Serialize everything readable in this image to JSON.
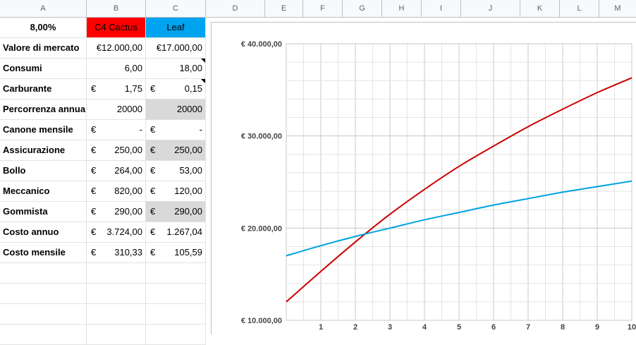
{
  "columns": [
    "A",
    "B",
    "C",
    "D",
    "E",
    "F",
    "G",
    "H",
    "I",
    "J",
    "K",
    "L",
    "M"
  ],
  "sheet": {
    "rate": "8,00%",
    "car_headers": [
      {
        "label": "C4 Cactus",
        "color": "#ff0000"
      },
      {
        "label": "Leaf",
        "color": "#00a3f0"
      }
    ],
    "rows": [
      {
        "label": "Valore di mercato",
        "b": {
          "cur": "",
          "val": "€12.000,00"
        },
        "c": {
          "cur": "",
          "val": "€17.000,00"
        }
      },
      {
        "label": "Consumi",
        "b": {
          "cur": "",
          "val": "6,00"
        },
        "c": {
          "cur": "",
          "val": "18,00"
        }
      },
      {
        "label": "Carburante",
        "b": {
          "cur": "€",
          "val": "1,75"
        },
        "c": {
          "cur": "€",
          "val": "0,15"
        }
      },
      {
        "label": "Percorrenza annua",
        "b": {
          "cur": "",
          "val": "20000"
        },
        "c": {
          "cur": "",
          "val": "20000"
        }
      },
      {
        "label": "Canone mensile",
        "b": {
          "cur": "€",
          "val": "-"
        },
        "c": {
          "cur": "€",
          "val": "-"
        }
      },
      {
        "label": "Assicurazione",
        "b": {
          "cur": "€",
          "val": "250,00"
        },
        "c": {
          "cur": "€",
          "val": "250,00"
        }
      },
      {
        "label": "Bollo",
        "b": {
          "cur": "€",
          "val": "264,00"
        },
        "c": {
          "cur": "€",
          "val": "53,00"
        }
      },
      {
        "label": "Meccanico",
        "b": {
          "cur": "€",
          "val": "820,00"
        },
        "c": {
          "cur": "€",
          "val": "120,00"
        }
      },
      {
        "label": "Gommista",
        "b": {
          "cur": "€",
          "val": "290,00"
        },
        "c": {
          "cur": "€",
          "val": "290,00"
        }
      },
      {
        "label": "Costo annuo",
        "b": {
          "cur": "€",
          "val": "3.724,00"
        },
        "c": {
          "cur": "€",
          "val": "1.267,04"
        }
      },
      {
        "label": "Costo mensile",
        "b": {
          "cur": "€",
          "val": "310,33"
        },
        "c": {
          "cur": "€",
          "val": "105,59"
        }
      }
    ]
  },
  "chart_data": {
    "type": "line",
    "x": [
      0,
      1,
      2,
      3,
      4,
      5,
      6,
      7,
      8,
      9,
      10
    ],
    "x_tick_labels": [
      "1",
      "2",
      "3",
      "4",
      "5",
      "6",
      "7",
      "8",
      "9",
      "10"
    ],
    "y_tick_labels": [
      "€ 10.000,00",
      "€ 20.000,00",
      "€ 30.000,00",
      "€ 40.000,00"
    ],
    "y_ticks": [
      10000,
      20000,
      30000,
      40000
    ],
    "ylim": [
      10000,
      40000
    ],
    "xlim": [
      0,
      10
    ],
    "grid": true,
    "series": [
      {
        "color": "#cc0000",
        "values": [
          12000,
          15300,
          18500,
          21500,
          24200,
          26700,
          28900,
          31000,
          32900,
          34700,
          36300
        ]
      },
      {
        "color": "#00a3e0",
        "values": [
          17000,
          18100,
          19100,
          20000,
          20900,
          21700,
          22500,
          23200,
          23900,
          24500,
          25100
        ]
      }
    ]
  }
}
